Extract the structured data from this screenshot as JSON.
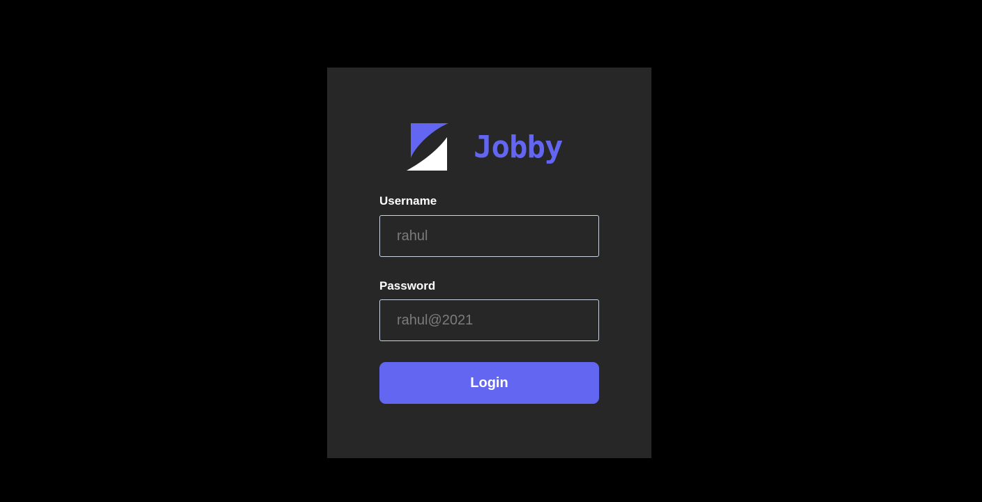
{
  "brand": {
    "name": "Jobby",
    "logo_icon": "jobby-logo-icon",
    "color": "#6366f1"
  },
  "form": {
    "username": {
      "label": "Username",
      "placeholder": "rahul",
      "value": ""
    },
    "password": {
      "label": "Password",
      "placeholder": "rahul@2021",
      "value": ""
    },
    "submit_label": "Login"
  },
  "colors": {
    "background": "#000000",
    "card": "#272727",
    "accent": "#6366f1",
    "label_text": "#ffffff",
    "input_border": "#cbd5e1"
  }
}
